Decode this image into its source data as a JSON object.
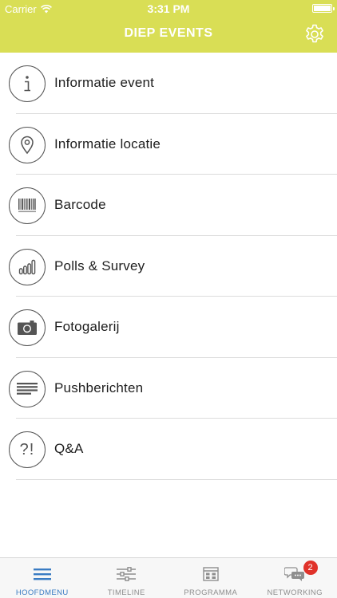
{
  "status_bar": {
    "carrier": "Carrier",
    "time": "3:31 PM"
  },
  "navbar": {
    "title": "DIEP EVENTS",
    "settings_icon": "gear-icon",
    "background": "#d9de55"
  },
  "menu": {
    "items": [
      {
        "label": "Informatie event",
        "icon": "info-icon"
      },
      {
        "label": "Informatie locatie",
        "icon": "location-pin-icon"
      },
      {
        "label": "Barcode",
        "icon": "barcode-icon"
      },
      {
        "label": "Polls & Survey",
        "icon": "bar-chart-icon"
      },
      {
        "label": "Fotogalerij",
        "icon": "camera-icon"
      },
      {
        "label": "Pushberichten",
        "icon": "message-lines-icon"
      },
      {
        "label": "Q&A",
        "icon": "question-exclamation-icon",
        "glyph": "?!"
      }
    ]
  },
  "tabbar": {
    "tabs": [
      {
        "label": "HOOFDMENU",
        "icon": "hamburger-icon",
        "active": true
      },
      {
        "label": "TIMELINE",
        "icon": "sliders-icon",
        "active": false
      },
      {
        "label": "PROGRAMMA",
        "icon": "calendar-icon",
        "active": false
      },
      {
        "label": "NETWORKING",
        "icon": "chat-bubbles-icon",
        "active": false,
        "badge": "2"
      }
    ],
    "active_color": "#3a7cc3"
  }
}
